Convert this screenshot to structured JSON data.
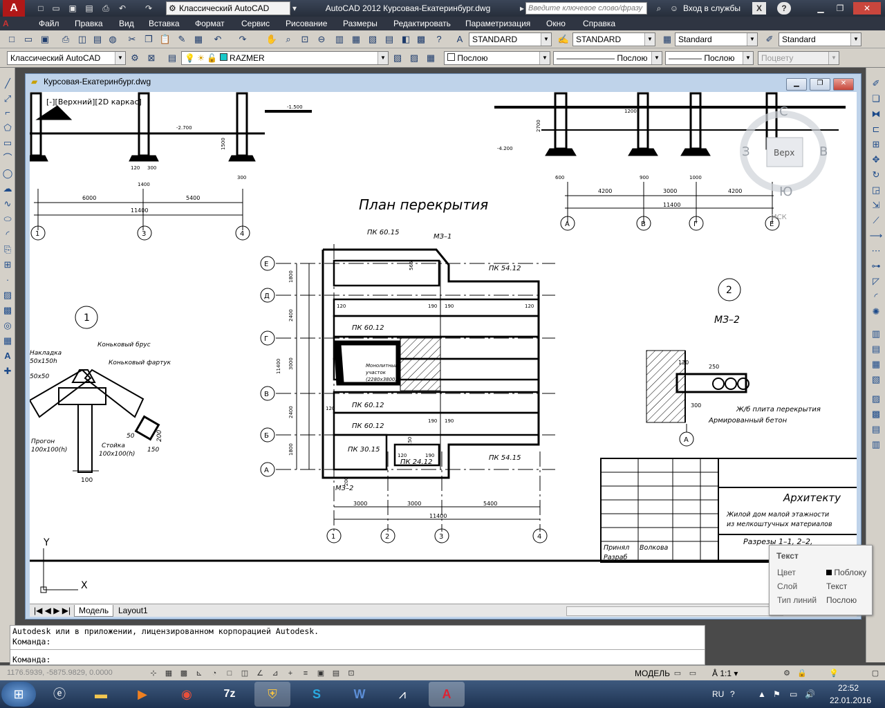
{
  "titlebar": {
    "workspace": "Классический AutoCAD",
    "app_title": "AutoCAD 2012   Курсовая-Екатеринбург.dwg",
    "search_placeholder": "Введите ключевое слово/фразу",
    "signin": "Вход в службы"
  },
  "menu": [
    "Файл",
    "Правка",
    "Вид",
    "Вставка",
    "Формат",
    "Сервис",
    "Рисование",
    "Размеры",
    "Редактировать",
    "Параметризация",
    "Окно",
    "Справка"
  ],
  "styles_toolbar": {
    "text_style": "STANDARD",
    "dim_style": "STANDARD",
    "table_style": "Standard",
    "multileader_style": "Standard"
  },
  "layers_toolbar": {
    "workspace": "Классический AutoCAD",
    "layer": "RAZMER",
    "color": "Послою",
    "linetype": "Послою",
    "lineweight": "Послою",
    "plotstyle": "Поцвету"
  },
  "drawing_window": {
    "title": "Курсовая-Екатеринбург.dwg",
    "viewport_label": "[-][Верхний][2D каркас]",
    "tabs": [
      "Модель",
      "Layout1"
    ]
  },
  "viewcube": {
    "north": "С",
    "south": "Ю",
    "west": "З",
    "east": "В",
    "top": "Верх",
    "ucs": "МСК"
  },
  "drawing": {
    "plan_title": "План перекрытия",
    "node1": "1",
    "node2": "2",
    "node2_title": "МЗ–2",
    "slabs": [
      "ПК 60.15",
      "МЗ–1",
      "ПК 54.12",
      "ПК 60.12",
      "ПК 60.12",
      "ПК 60.12",
      "ПК 30.15",
      "ПК 24.12",
      "ПК 54.15",
      "МЗ–2"
    ],
    "monolith_note": [
      "Монолитный",
      "участок",
      "(2280х3800)"
    ],
    "axes_letters": [
      "Е",
      "Д",
      "Г",
      "В",
      "Б",
      "А"
    ],
    "axes_numbers": [
      "1",
      "2",
      "3",
      "4"
    ],
    "bottom_dims": [
      "3000",
      "3000",
      "5400",
      "11400"
    ],
    "left_dims": [
      "1800",
      "2400",
      "3000",
      "2400",
      "1800",
      "11400"
    ],
    "detail1_labels": [
      "Коньковый брус",
      "Коньковый фартук",
      "Накладка",
      "50х150h",
      "50х50",
      "Прогон",
      "100х100(h)",
      "Стойка",
      "100х100(h)",
      "50",
      "150",
      "200",
      "100"
    ],
    "detail2_labels": [
      "Ж/б плита перекрытия",
      "Армированный бетон",
      "250",
      "300",
      "120",
      "А"
    ],
    "top_left_dims": [
      "6000",
      "5400",
      "11400",
      "1",
      "3",
      "4"
    ],
    "top_right_dims": [
      "4200",
      "3000",
      "4200",
      "11400",
      "А",
      "В",
      "Г",
      "Е"
    ],
    "small_dims": [
      "120",
      "565",
      "190",
      "190",
      "120",
      "120",
      "190",
      "190",
      "120",
      "150",
      "190",
      "200",
      "120",
      "300",
      "1200",
      "-1.500",
      "-2.700",
      "-4.200",
      "2700",
      "1500",
      "300",
      "600",
      "1400",
      "900",
      "1000"
    ],
    "title_block": {
      "company": "Архитекту",
      "project": [
        "Жилой дом малой этажности",
        "из мелкоштучных материалов"
      ],
      "sheet": "Разрезы 1–1, 2–2,",
      "roles": [
        "Принял",
        "Разраб"
      ],
      "person": "Волкова"
    }
  },
  "properties_popup": {
    "title": "Текст",
    "rows": [
      {
        "label": "Цвет",
        "value": "Поблоку"
      },
      {
        "label": "Слой",
        "value": "Текст"
      },
      {
        "label": "Тип линий",
        "value": "Послою"
      }
    ]
  },
  "command": {
    "history": "Autodesk или в приложении, лицензированном корпорацией Autodesk.",
    "prompt1": "Команда:",
    "prompt2": "Команда:"
  },
  "status": {
    "coords": "1176.5939, -5875.9829, 0.0000",
    "model": "МОДЕЛЬ",
    "scale": "1:1"
  },
  "taskbar": {
    "lang": "RU",
    "time": "22:52",
    "date": "22.01.2016"
  },
  "colors": {
    "titlebar": "#2f3542",
    "toolbar": "#d4d0c8",
    "canvas": "#ffffff",
    "taskbar": "#2b4566"
  }
}
